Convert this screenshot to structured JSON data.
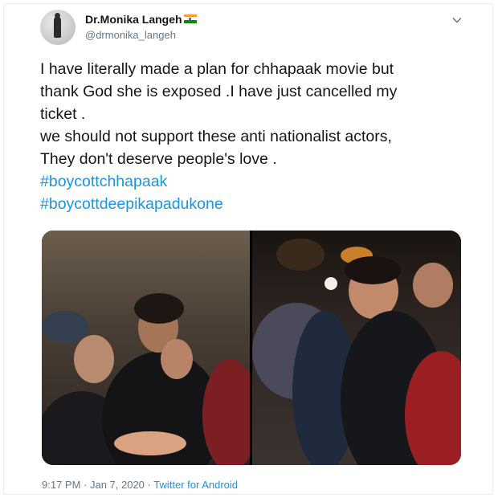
{
  "tweet": {
    "display_name": "Dr.Monika Langeh",
    "handle": "@drmonika_langeh",
    "text_lines": [
      "I have literally made a plan for chhapaak movie but",
      "thank God she is exposed .I have just cancelled my",
      "ticket .",
      "we should not support these anti nationalist actors,",
      "They don't deserve people's love ."
    ],
    "hashtags": [
      "#boycottchhapaak",
      "#boycottdeepikapadukone"
    ],
    "time": "9:17 PM · Jan 7, 2020 · ",
    "source": "Twitter for Android",
    "icons": {
      "menu": "chevron-down-icon",
      "flag": "india-flag-icon"
    }
  },
  "colors": {
    "text": "#14171a",
    "secondary": "#657786",
    "link": "#1b95e0",
    "border": "#e6ecf0"
  }
}
